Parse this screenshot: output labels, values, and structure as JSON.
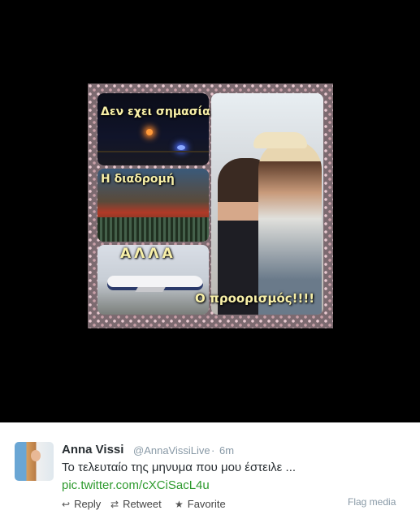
{
  "media": {
    "collage": {
      "text_1": "Δεν εχει σημασία",
      "text_2": "Η διαδρομή",
      "text_3": "ΑΛΛΑ",
      "text_4": "Ο προορισμός!!!!"
    }
  },
  "tweet": {
    "author_name": "Anna Vissi",
    "author_handle": "@AnnaVissiLive",
    "separator": "·",
    "timestamp": "6m",
    "text": "Το τελευταίο της μηνυμα που μου έστειλε ...",
    "link": "pic.twitter.com/cXCiSacL4u",
    "actions": {
      "reply": "Reply",
      "retweet": "Retweet",
      "favorite": "Favorite"
    },
    "flag_media": "Flag media"
  },
  "icons": {
    "reply": "reply-icon",
    "retweet": "retweet-icon",
    "favorite": "star-icon"
  },
  "colors": {
    "link": "#2e9a2e",
    "meta": "#8899a6",
    "media_background": "#000000"
  }
}
